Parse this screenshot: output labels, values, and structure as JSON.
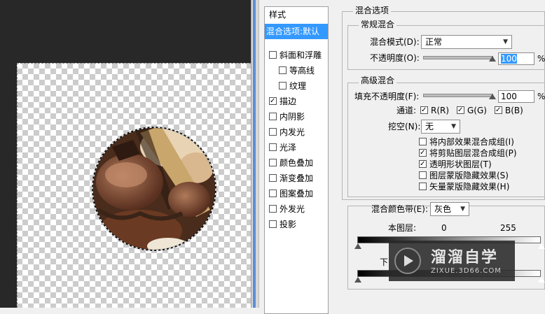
{
  "styles_panel": {
    "header": "样式",
    "selected": "混合选项:默认",
    "items": [
      {
        "label": "斜面和浮雕",
        "checked": false,
        "indent": false
      },
      {
        "label": "等高线",
        "checked": false,
        "indent": true
      },
      {
        "label": "纹理",
        "checked": false,
        "indent": true
      },
      {
        "label": "描边",
        "checked": true,
        "indent": false
      },
      {
        "label": "内阴影",
        "checked": false,
        "indent": false
      },
      {
        "label": "内发光",
        "checked": false,
        "indent": false
      },
      {
        "label": "光泽",
        "checked": false,
        "indent": false
      },
      {
        "label": "颜色叠加",
        "checked": false,
        "indent": false
      },
      {
        "label": "渐变叠加",
        "checked": false,
        "indent": false
      },
      {
        "label": "图案叠加",
        "checked": false,
        "indent": false
      },
      {
        "label": "外发光",
        "checked": false,
        "indent": false
      },
      {
        "label": "投影",
        "checked": false,
        "indent": false
      }
    ]
  },
  "blend_options": {
    "title": "混合选项",
    "general": {
      "title": "常规混合",
      "mode_label": "混合模式(D):",
      "mode_value": "正常",
      "opacity_label": "不透明度(O):",
      "opacity_value": "100",
      "unit": "%"
    },
    "advanced": {
      "title": "高级混合",
      "fill_label": "填充不透明度(F):",
      "fill_value": "100",
      "unit": "%",
      "channels_label": "通道:",
      "channels": [
        {
          "label": "R(R)",
          "checked": true
        },
        {
          "label": "G(G)",
          "checked": true
        },
        {
          "label": "B(B)",
          "checked": true
        }
      ],
      "knockout_label": "挖空(N):",
      "knockout_value": "无",
      "options": [
        {
          "label": "将内部效果混合成组(I)",
          "checked": false
        },
        {
          "label": "将剪贴图层混合成组(P)",
          "checked": true
        },
        {
          "label": "透明形状图层(T)",
          "checked": true
        },
        {
          "label": "图层蒙版隐藏效果(S)",
          "checked": false
        },
        {
          "label": "矢量蒙版隐藏效果(H)",
          "checked": false
        }
      ]
    },
    "blend_if": {
      "label": "混合颜色带(E):",
      "value": "灰色",
      "this_layer_label": "本图层:",
      "this_layer_min": "0",
      "this_layer_max": "255",
      "underlying_label": "下"
    }
  },
  "watermark": {
    "title": "溜溜自学",
    "url": "ZIXUE.3D66.COM"
  },
  "colors": {
    "selection": "#3399ff",
    "canvas_bg": "#282828",
    "panel_bg": "#f0f0f0"
  }
}
